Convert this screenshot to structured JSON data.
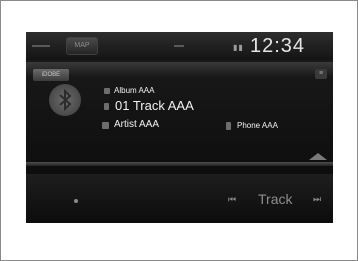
{
  "status_bar": {
    "map_label": "MAP",
    "clock": "12:34"
  },
  "source": {
    "tab_label": "iDOBE"
  },
  "now_playing": {
    "album": "Album AAA",
    "track": "01 Track AAA",
    "artist": "Artist AAA",
    "phone": "Phone AAA"
  },
  "controls": {
    "prev_symbol": "⏮",
    "next_symbol": "⏭",
    "track_label": "Track"
  },
  "icons": {
    "album": "album-icon",
    "track": "track-number-icon",
    "artist": "artist-icon",
    "phone": "phone-icon",
    "art": "bluetooth-icon"
  }
}
